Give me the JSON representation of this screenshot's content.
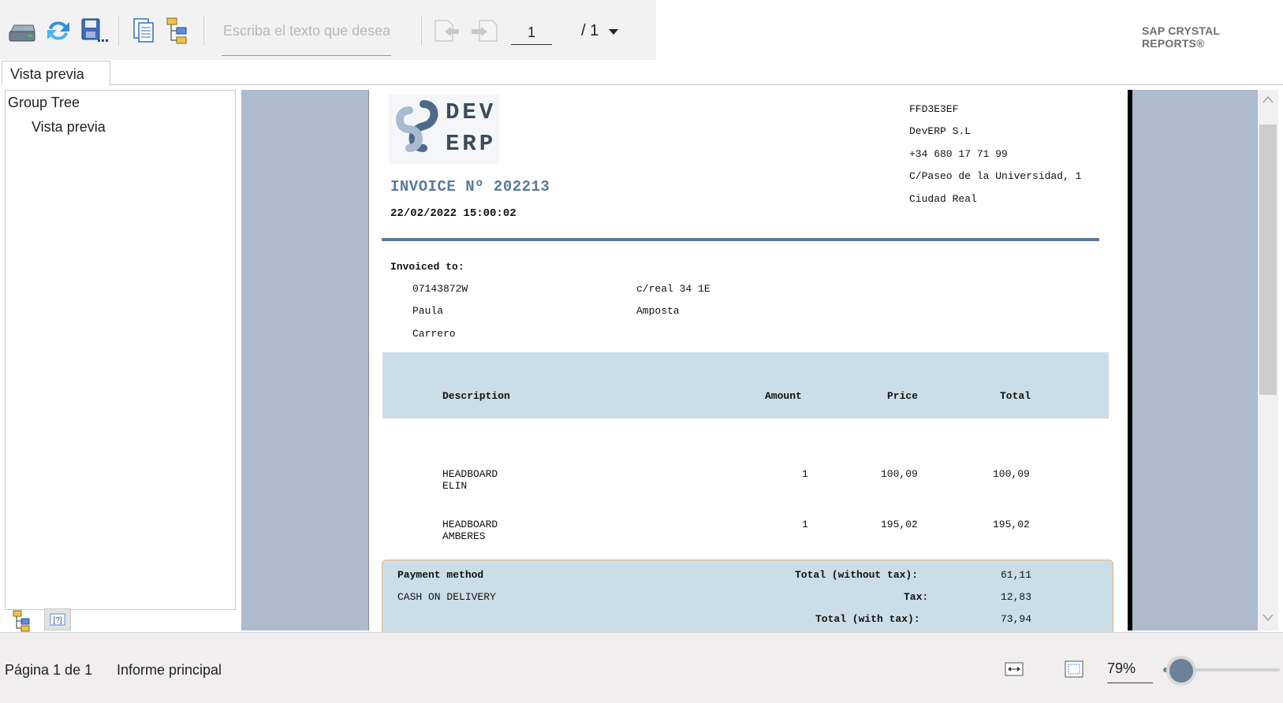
{
  "toolbar": {
    "buttons": [
      "print-icon",
      "refresh-icon",
      "export-icon",
      "copy-icon",
      "group-tree-icon"
    ],
    "search_placeholder": "Escriba el texto que desea",
    "current_page": "1",
    "page_total": "/ 1",
    "brand": "SAP CRYSTAL REPORTS®"
  },
  "tabs": [
    {
      "label": "Vista previa"
    }
  ],
  "group_tree": {
    "title": "Group Tree",
    "items": [
      {
        "label": "Vista previa"
      }
    ]
  },
  "invoice": {
    "logo_line1": "DEV",
    "logo_line2": "ERP",
    "title": "INVOICE Nº 202213",
    "datetime": "22/02/2022 15:00:02",
    "company": {
      "code": "FFD3E3EF",
      "name": "DevERP S.L",
      "phone": "+34 680 17 71 99",
      "address": "C/Paseo de la Universidad, 1",
      "city": "Ciudad Real"
    },
    "invoiced_to_label": "Invoiced to:",
    "client": {
      "id": "07143872W",
      "first_name": "Paula",
      "last_name": "Carrero",
      "address": "c/real 34 1E",
      "city": "Amposta"
    },
    "columns": {
      "description": "Description",
      "amount": "Amount",
      "price": "Price",
      "total": "Total"
    },
    "lines": [
      {
        "description": "HEADBOARD ELIN",
        "amount": "1",
        "price": "100,09",
        "total": "100,09"
      },
      {
        "description": "HEADBOARD AMBERES",
        "amount": "1",
        "price": "195,02",
        "total": "195,02"
      }
    ],
    "payment_method_label": "Payment method",
    "payment_method": "CASH ON DELIVERY",
    "totals": {
      "without_tax_label": "Total (without tax):",
      "without_tax": "61,11",
      "tax_label": "Tax:",
      "tax": "12,83",
      "with_tax_label": "Total (with tax):",
      "with_tax": "73,94"
    }
  },
  "status": {
    "page_label": "Página 1 de 1",
    "report_label": "Informe principal",
    "zoom": "79%",
    "zoom_percent": 79
  },
  "colors": {
    "accent": "#5b7a9c",
    "table_fill": "#cbdde6",
    "preview_background": "#aebace",
    "footer_border": "#f0b26a"
  }
}
